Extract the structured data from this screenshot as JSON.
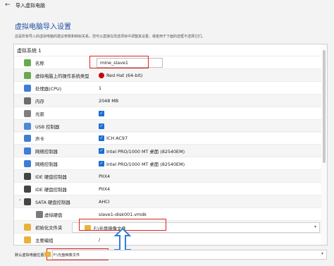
{
  "window": {
    "back_icon": "back-arrow-icon",
    "title": "导入虚拟电脑"
  },
  "page": {
    "heading": "虚拟电脑导入设置",
    "desc_text": "这是所有导入的虚拟电脑的建议参数和映射关系。您可以直接在改选项目中调整其设置，或者用于下面的选框不选择它们。",
    "group_title": "虚拟系统 1"
  },
  "rows": [
    {
      "icon": "name-icon",
      "label": "名称",
      "value": "mine_slave1",
      "type": "field"
    },
    {
      "icon": "os-type-icon",
      "label": "虚拟电脑上的操作系统类型",
      "value": "Red Hat (64-bit)",
      "type": "text",
      "badge": "redhat-icon"
    },
    {
      "icon": "cpu-icon",
      "label": "处理器(CPU)",
      "value": "1",
      "type": "text"
    },
    {
      "icon": "memory-icon",
      "label": "内存",
      "value": "2048 MB",
      "type": "text"
    },
    {
      "icon": "optical-drive-icon",
      "label": "光驱",
      "value": "",
      "type": "check"
    },
    {
      "icon": "usb-icon",
      "label": "USB 控制器",
      "value": "",
      "type": "check"
    },
    {
      "icon": "sound-icon",
      "label": "声卡",
      "value": "ICH AC97",
      "type": "check"
    },
    {
      "icon": "network-icon",
      "label": "网络控制器",
      "value": "Intel PRO/1000 MT 桌面 (82540EM)",
      "type": "check"
    },
    {
      "icon": "network-icon",
      "label": "网络控制器",
      "value": "Intel PRO/1000 MT 桌面 (82540EM)",
      "type": "check"
    },
    {
      "icon": "ide-controller-icon",
      "label": "IDE 硬盘控制器",
      "value": "PIIX4",
      "type": "text"
    },
    {
      "icon": "ide-controller-icon",
      "label": "IDE 硬盘控制器",
      "value": "PIIX4",
      "type": "text"
    },
    {
      "icon": "sata-controller-icon",
      "label": "SATA 硬盘控制器",
      "value": "AHCI",
      "type": "text",
      "expanded": true
    },
    {
      "icon": "virtual-disk-icon",
      "label": "虚拟硬盘",
      "value": "slave1-disk001.vmdk",
      "type": "text",
      "indent": true
    },
    {
      "icon": "folder-icon",
      "label": "初始化文件夹",
      "value": "F:\\光盘映像文件",
      "type": "dropdown"
    },
    {
      "icon": "primary-group-icon",
      "label": "主要编组",
      "value": "/",
      "type": "text"
    }
  ],
  "bottom": {
    "label": "默认虚拟电脑位置(M):",
    "path": "F:\\光盘映像文件"
  },
  "colors": {
    "accent": "#1a6fd1",
    "highlight": "#e02020",
    "arrow": "#2f7fd9",
    "folder": "#e9b33a"
  }
}
